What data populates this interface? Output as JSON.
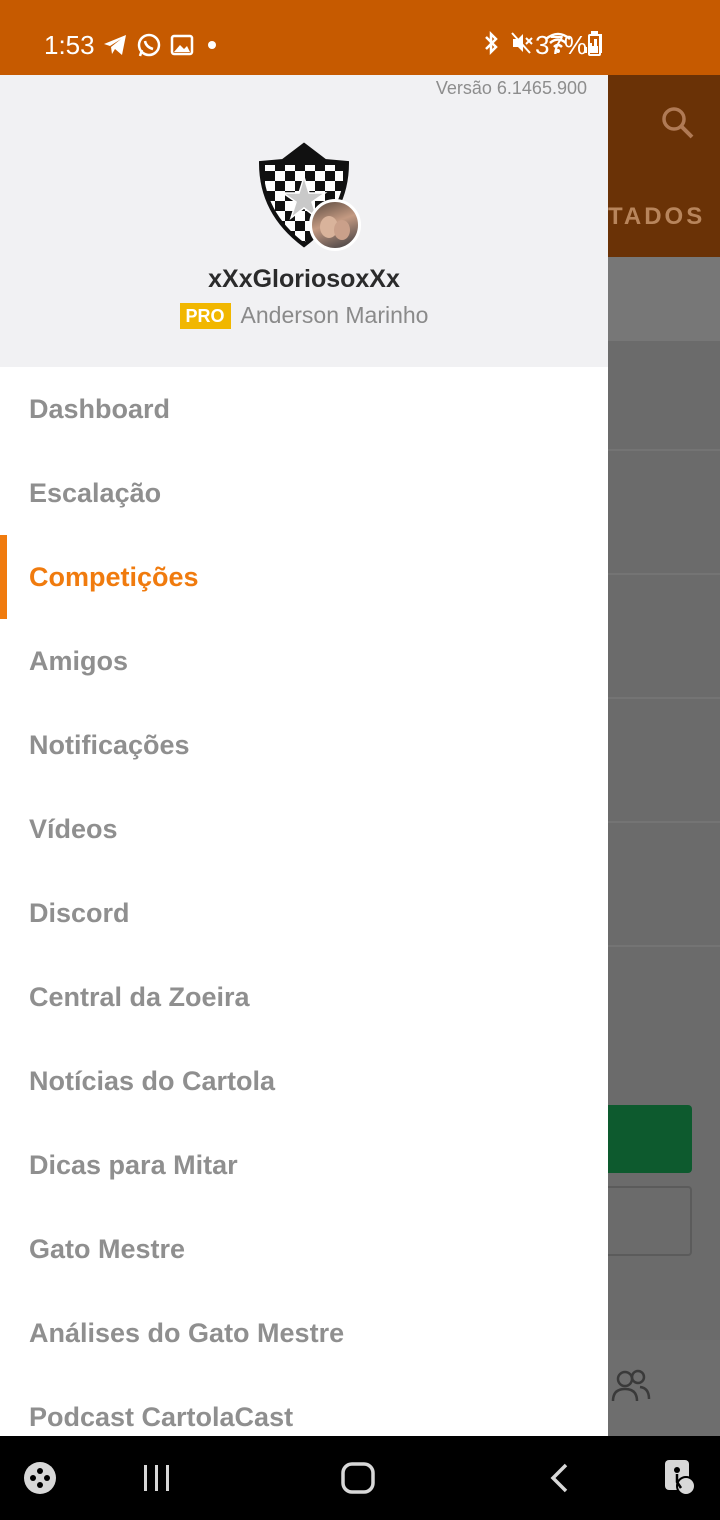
{
  "status_bar": {
    "time": "1:53",
    "battery": "37%",
    "left_icons": [
      "telegram-icon",
      "whatsapp-icon",
      "gallery-icon",
      "dot-icon"
    ],
    "right_icons": [
      "bluetooth-icon",
      "mute-icon",
      "wifi-icon",
      "signal-icon",
      "battery-icon"
    ]
  },
  "background_app": {
    "tab_partial": "TADOS",
    "search_icon": "search-icon",
    "people_icon": "people-icon"
  },
  "drawer": {
    "version": "Versão 6.1465.900",
    "team_name": "xXxGloriosoxXx",
    "pro_badge": "PRO",
    "owner_name": "Anderson Marinho",
    "active_index": 2,
    "menu": [
      {
        "label": "Dashboard"
      },
      {
        "label": "Escalação"
      },
      {
        "label": "Competições"
      },
      {
        "label": "Amigos"
      },
      {
        "label": "Notificações"
      },
      {
        "label": "Vídeos"
      },
      {
        "label": "Discord"
      },
      {
        "label": "Central da Zoeira"
      },
      {
        "label": "Notícias do Cartola"
      },
      {
        "label": "Dicas para Mitar"
      },
      {
        "label": "Gato Mestre"
      },
      {
        "label": "Análises do Gato Mestre"
      },
      {
        "label": "Podcast CartolaCast"
      }
    ]
  },
  "nav_bar": {
    "icons": [
      "game-launcher-icon",
      "recent-apps-icon",
      "home-icon",
      "back-icon",
      "accessibility-icon"
    ]
  },
  "colors": {
    "status_bar": "#c65a00",
    "accent": "#f07b0e",
    "pro_badge": "#f1b700",
    "menu_text": "#8f8f8f"
  }
}
